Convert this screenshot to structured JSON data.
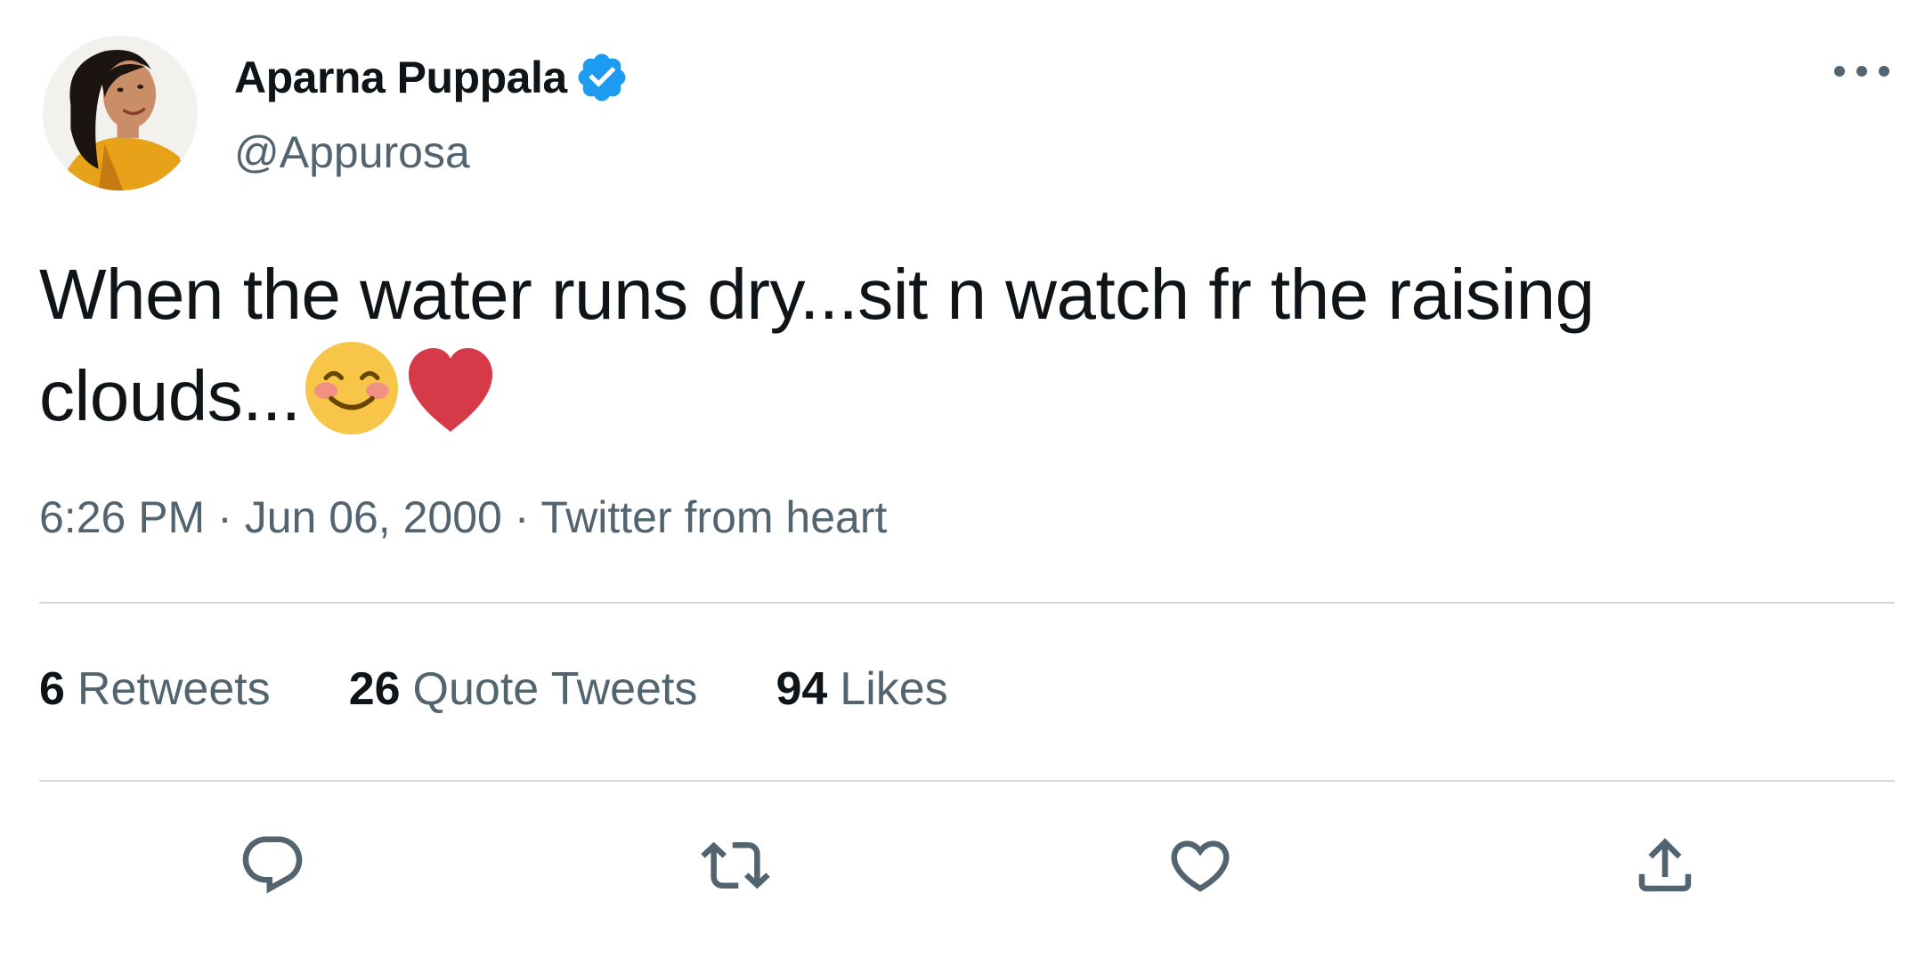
{
  "tweet": {
    "author": {
      "name": "Aparna Puppala",
      "handle": "@Appurosa",
      "verified": true
    },
    "text": "When the water runs dry...sit n watch fr the raising clouds...",
    "emojis": [
      "smiling-face-with-smiling-eyes",
      "red-heart"
    ],
    "time": "6:26 PM",
    "date": "Jun 06, 2000",
    "source": "Twitter from heart",
    "separator": "·",
    "stats": {
      "retweets": {
        "count": "6",
        "label": "Retweets"
      },
      "quotes": {
        "count": "26",
        "label": "Quote Tweets"
      },
      "likes": {
        "count": "94",
        "label": "Likes"
      }
    }
  },
  "icons": {
    "verified": "verified-badge-icon",
    "more": "more-options-icon",
    "reply": "reply-icon",
    "retweet": "retweet-icon",
    "like": "like-icon",
    "share": "share-icon"
  },
  "colors": {
    "text_primary": "#0f1419",
    "text_secondary": "#536471",
    "verified_blue": "#1d9bf0",
    "divider": "#cfd9de",
    "heart_red": "#d63a48",
    "emoji_yellow": "#f7c548"
  }
}
